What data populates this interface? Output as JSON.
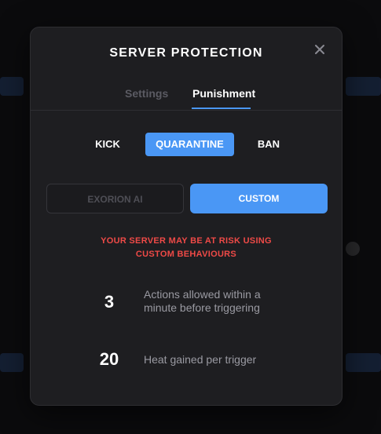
{
  "modal": {
    "title": "SERVER PROTECTION",
    "close_icon": "close-icon"
  },
  "tabs": [
    {
      "label": "Settings",
      "active": false
    },
    {
      "label": "Punishment",
      "active": true
    }
  ],
  "punishment_modes": [
    {
      "label": "KICK",
      "selected": false
    },
    {
      "label": "QUARANTINE",
      "selected": true
    },
    {
      "label": "BAN",
      "selected": false
    }
  ],
  "source_options": [
    {
      "label": "EXORION AI",
      "selected": false
    },
    {
      "label": "CUSTOM",
      "selected": true
    }
  ],
  "warning": {
    "line1": "YOUR SERVER MAY BE AT RISK USING",
    "line2": "CUSTOM BEHAVIOURS"
  },
  "stats": [
    {
      "value": "3",
      "desc_line1": "Actions allowed within a",
      "desc_line2": "minute before triggering"
    },
    {
      "value": "20",
      "desc_line1": "Heat gained per trigger",
      "desc_line2": ""
    }
  ],
  "colors": {
    "accent": "#4a97f5",
    "warning": "#ef4a47",
    "modal_bg": "#1e1e21",
    "page_bg": "#0b0b0d"
  }
}
